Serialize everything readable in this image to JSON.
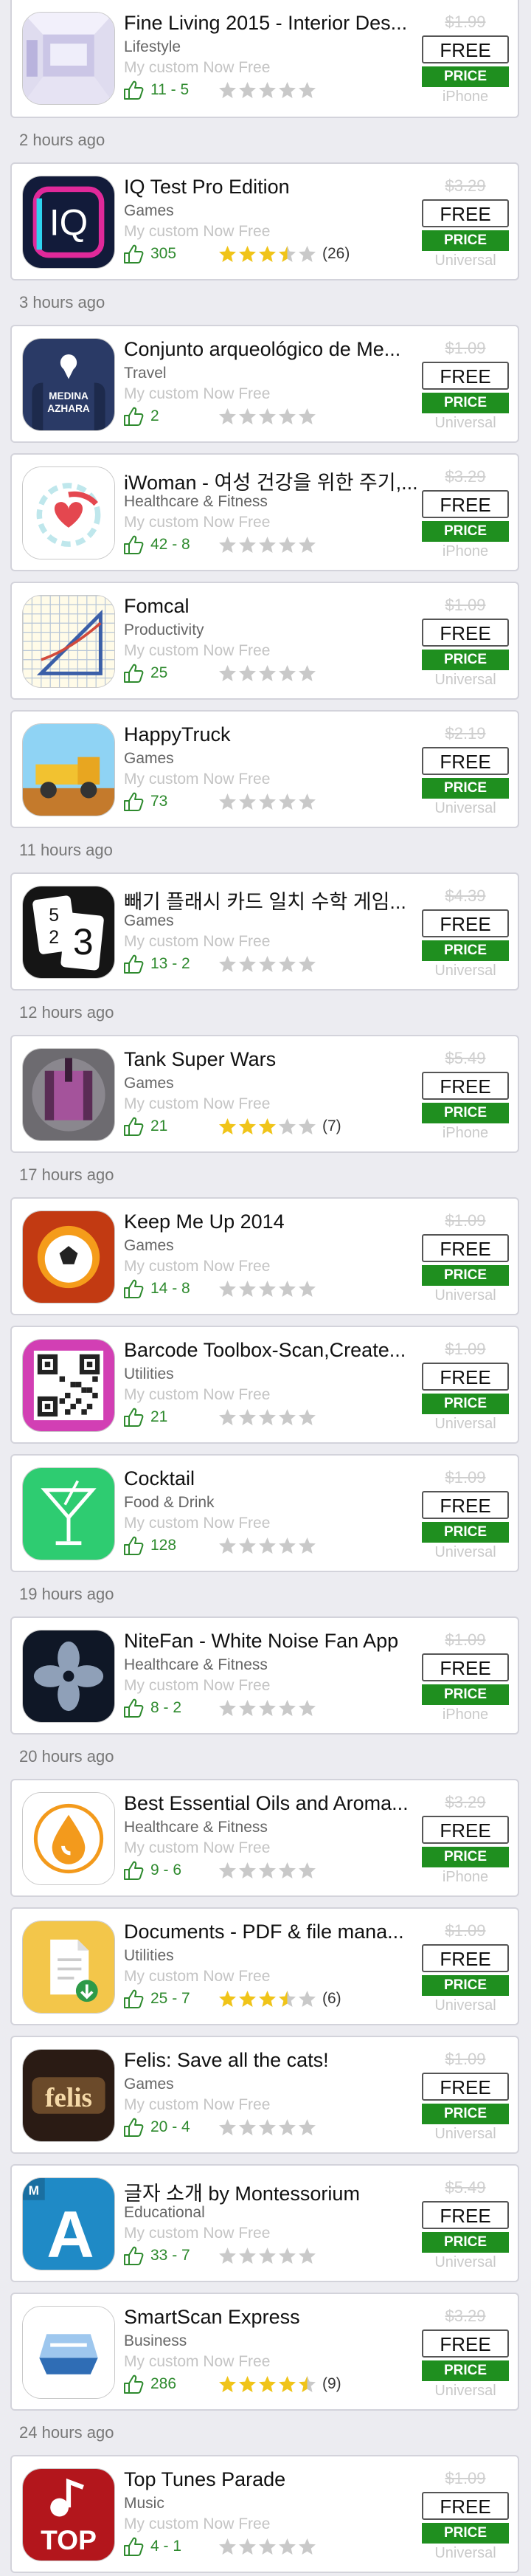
{
  "colors": {
    "accent_green": "#1f8f1f",
    "star_gold": "#f0c419",
    "star_empty": "#c9c9c9",
    "background": "#ececf1"
  },
  "rating_max": 5,
  "sections": [
    {
      "header": "",
      "apps": [
        {
          "name": "Fine Living 2015 - Interior Des...",
          "category": "Lifestyle",
          "note": "My custom Now Free",
          "votes": "11 - 5",
          "rating": 0,
          "rating_count": "",
          "old_price": "$1.99",
          "action": "FREE",
          "price_label": "PRICE",
          "device": "iPhone",
          "icon": "interior-room-icon"
        }
      ]
    },
    {
      "header": "2 hours ago",
      "apps": [
        {
          "name": "IQ Test Pro Edition",
          "category": "Games",
          "note": "My custom Now Free",
          "votes": "305",
          "rating": 3.5,
          "rating_count": "(26)",
          "old_price": "$3.29",
          "action": "FREE",
          "price_label": "PRICE",
          "device": "Universal",
          "icon": "iq-logo-icon"
        }
      ]
    },
    {
      "header": "3 hours ago",
      "apps": [
        {
          "name": "Conjunto arqueológico de Me...",
          "category": "Travel",
          "note": "My custom Now Free",
          "votes": "2",
          "rating": 0,
          "rating_count": "",
          "old_price": "$1.09",
          "action": "FREE",
          "price_label": "PRICE",
          "device": "Universal",
          "icon": "medina-azahara-icon",
          "icon_text": [
            "MEDINA",
            "AZHARA"
          ]
        },
        {
          "name": "iWoman - 여성 건강을 위한 주기,...",
          "category": "Healthcare & Fitness",
          "note": "My custom Now Free",
          "votes": "42 - 8",
          "rating": 0,
          "rating_count": "",
          "old_price": "$3.29",
          "action": "FREE",
          "price_label": "PRICE",
          "device": "iPhone",
          "icon": "heart-cycle-icon"
        },
        {
          "name": "Fomcal",
          "category": "Productivity",
          "note": "My custom Now Free",
          "votes": "25",
          "rating": 0,
          "rating_count": "",
          "old_price": "$1.09",
          "action": "FREE",
          "price_label": "PRICE",
          "device": "Universal",
          "icon": "formula-calculator-icon"
        },
        {
          "name": "HappyTruck",
          "category": "Games",
          "note": "My custom Now Free",
          "votes": "73",
          "rating": 0,
          "rating_count": "",
          "old_price": "$2.19",
          "action": "FREE",
          "price_label": "PRICE",
          "device": "Universal",
          "icon": "truck-icon"
        }
      ]
    },
    {
      "header": "11 hours ago",
      "apps": [
        {
          "name": "빼기 플래시 카드 일치 수학 게임...",
          "category": "Games",
          "note": "My custom Now Free",
          "votes": "13 - 2",
          "rating": 0,
          "rating_count": "",
          "old_price": "$4.39",
          "action": "FREE",
          "price_label": "PRICE",
          "device": "Universal",
          "icon": "flash-cards-icon",
          "icon_text": [
            "5",
            "2",
            "3"
          ]
        }
      ]
    },
    {
      "header": "12 hours ago",
      "apps": [
        {
          "name": "Tank Super Wars",
          "category": "Games",
          "note": "My custom Now Free",
          "votes": "21",
          "rating": 3,
          "rating_count": "(7)",
          "old_price": "$5.49",
          "action": "FREE",
          "price_label": "PRICE",
          "device": "iPhone",
          "icon": "tank-icon"
        }
      ]
    },
    {
      "header": "17 hours ago",
      "apps": [
        {
          "name": "Keep Me Up 2014",
          "category": "Games",
          "note": "My custom Now Free",
          "votes": "14 - 8",
          "rating": 0,
          "rating_count": "",
          "old_price": "$1.09",
          "action": "FREE",
          "price_label": "PRICE",
          "device": "Universal",
          "icon": "soccer-ball-icon"
        },
        {
          "name": "Barcode Toolbox-Scan,Create...",
          "category": "Utilities",
          "note": "My custom Now Free",
          "votes": "21",
          "rating": 0,
          "rating_count": "",
          "old_price": "$1.09",
          "action": "FREE",
          "price_label": "PRICE",
          "device": "Universal",
          "icon": "qr-code-icon"
        },
        {
          "name": "Cocktail",
          "category": "Food & Drink",
          "note": "My custom Now Free",
          "votes": "128",
          "rating": 0,
          "rating_count": "",
          "old_price": "$1.09",
          "action": "FREE",
          "price_label": "PRICE",
          "device": "Universal",
          "icon": "cocktail-glass-icon"
        }
      ]
    },
    {
      "header": "19 hours ago",
      "apps": [
        {
          "name": "NiteFan - White Noise Fan App",
          "category": "Healthcare & Fitness",
          "note": "My custom Now Free",
          "votes": "8 - 2",
          "rating": 0,
          "rating_count": "",
          "old_price": "$1.09",
          "action": "FREE",
          "price_label": "PRICE",
          "device": "iPhone",
          "icon": "fan-icon"
        }
      ]
    },
    {
      "header": "20 hours ago",
      "apps": [
        {
          "name": "Best Essential Oils and Aroma...",
          "category": "Healthcare & Fitness",
          "note": "My custom Now Free",
          "votes": "9 - 6",
          "rating": 0,
          "rating_count": "",
          "old_price": "$3.29",
          "action": "FREE",
          "price_label": "PRICE",
          "device": "iPhone",
          "icon": "oil-drop-icon"
        },
        {
          "name": "Documents - PDF & file mana...",
          "category": "Utilities",
          "note": "My custom Now Free",
          "votes": "25 - 7",
          "rating": 3.5,
          "rating_count": "(6)",
          "old_price": "$1.09",
          "action": "FREE",
          "price_label": "PRICE",
          "device": "Universal",
          "icon": "document-download-icon"
        },
        {
          "name": "Felis: Save all the cats!",
          "category": "Games",
          "note": "My custom Now Free",
          "votes": "20 - 4",
          "rating": 0,
          "rating_count": "",
          "old_price": "$1.09",
          "action": "FREE",
          "price_label": "PRICE",
          "device": "Universal",
          "icon": "felis-logo-icon",
          "icon_text": [
            "felis"
          ]
        },
        {
          "name": "글자 소개 by Montessorium",
          "category": "Educational",
          "note": "My custom Now Free",
          "votes": "33 - 7",
          "rating": 0,
          "rating_count": "",
          "old_price": "$5.49",
          "action": "FREE",
          "price_label": "PRICE",
          "device": "Universal",
          "icon": "letter-a-icon",
          "icon_text": [
            "A",
            "M"
          ]
        },
        {
          "name": "SmartScan Express",
          "category": "Business",
          "note": "My custom Now Free",
          "votes": "286",
          "rating": 4.5,
          "rating_count": "(9)",
          "old_price": "$3.29",
          "action": "FREE",
          "price_label": "PRICE",
          "device": "Universal",
          "icon": "scanner-icon"
        }
      ]
    },
    {
      "header": "24 hours ago",
      "apps": [
        {
          "name": "Top Tunes Parade",
          "category": "Music",
          "note": "My custom Now Free",
          "votes": "4 - 1",
          "rating": 0,
          "rating_count": "",
          "old_price": "$1.09",
          "action": "FREE",
          "price_label": "PRICE",
          "device": "Universal",
          "icon": "music-note-icon",
          "icon_text": [
            "TOP"
          ]
        }
      ]
    }
  ]
}
